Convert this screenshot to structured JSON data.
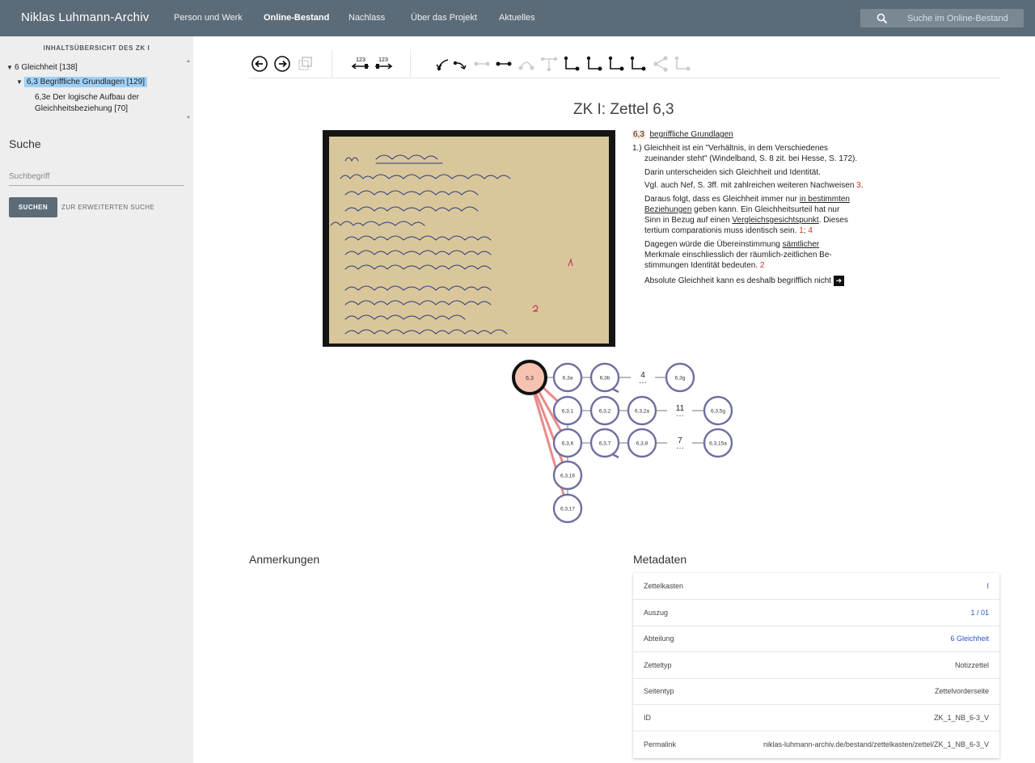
{
  "header": {
    "brand": "Niklas Luhmann-Archiv",
    "nav": [
      "Person und Werk",
      "Online-Bestand",
      "Nachlass",
      "Über das Projekt",
      "Aktuelles"
    ],
    "active_nav": "Online-Bestand",
    "search_placeholder": "Suche im Online-Bestand",
    "bg_color": "#5b6b78"
  },
  "sidebar": {
    "toc_title": "INHALTSÜBERSICHT DES ZK I",
    "tree": [
      {
        "label": "6 Gleichheit [138]",
        "expanded": true
      },
      {
        "label": "6,3 Begriffliche Grundlagen [129]",
        "expanded": true,
        "selected": true
      },
      {
        "label_line1": "6,3e Der logische Aufbau der",
        "label_line2": "Gleichheitsbeziehung [70]"
      }
    ],
    "search_heading": "Suche",
    "search_placeholder": "Suchbegriff",
    "search_button": "SUCHEN",
    "advanced_link": "ZUR ERWEITERTEN SUCHE"
  },
  "toolbar": {
    "icons": [
      "back-arrow-icon",
      "forward-arrow-icon",
      "copy-icon",
      "number-left-icon",
      "number-right-icon",
      "link-in-icon",
      "link-out-icon",
      "link-prev-icon",
      "link-next-icon",
      "link-arc-icon",
      "link-tree-icon",
      "link-down-icon",
      "link-down-icon",
      "link-down-icon",
      "link-down-icon",
      "share-icon",
      "link-down-icon"
    ],
    "num_label": "123"
  },
  "note": {
    "title": "ZK I: Zettel 6,3",
    "transcript": {
      "number": "6,3",
      "heading": "begriffliche Grundlagen",
      "l1": "1.) Gleichheit ist ein \"Verhältnis, in dem Verschiedenes",
      "l2": "zueinander steht\" (Windelband, S. 8 zit. bei Hesse, S. 172).",
      "l3": "Darin unterscheiden sich Gleichheit und Identität.",
      "l4a": "Vgl. auch Nef, S. 3ff. mit zahlreichen weiteren Nachweisen",
      "l4ref": "3",
      "l5a": "Daraus folgt, dass es Gleichheit immer nur",
      "l5u": "in bestimmten",
      "l6u": "Beziehungen",
      "l6b": "geben kann. Ein Gleichheitsurteil hat nur",
      "l7a": "Sinn in Bezug auf einen",
      "l7u": "Vergleichsgesichtspunkt",
      "l7b": ". Dieses",
      "l8a": "tertium comparationis muss identisch sein.",
      "l8r1": "1",
      "l8r2": "4",
      "l9a": "Dagegen würde die Übereinstimmung",
      "l9u": "sämtlicher",
      "l10": "Merkmale einschliesslich der räumlich-zeitlichen Be-",
      "l11a": "stimmungen Identität bedeuten.",
      "l11r": "2",
      "l12": "Absolute Gleichheit kann es deshalb begrifflich nicht"
    }
  },
  "graph": {
    "current": "6,3",
    "nodes": [
      "6,3a",
      "6,3b",
      "6,3g",
      "6,3,1",
      "6,3,2",
      "6,3,2a",
      "6,3,5g",
      "6,3,6",
      "6,3,7",
      "6,3,8",
      "6,3,15a",
      "6,3,16",
      "6,3,17"
    ],
    "gaps": [
      "4",
      "11",
      "7"
    ],
    "current_color": "#f7c3b1",
    "node_stroke": "#6f6fa0",
    "link_color": "#e88a8a"
  },
  "sections": {
    "notes_heading": "Anmerkungen",
    "meta_heading": "Metadaten"
  },
  "metadata": [
    {
      "key": "Zettelkasten",
      "value": "I",
      "link": true
    },
    {
      "key": "Auszug",
      "value": "1 / 01",
      "link": true
    },
    {
      "key": "Abteilung",
      "value": "6 Gleichheit",
      "link": true
    },
    {
      "key": "Zetteltyp",
      "value": "Notizzettel",
      "link": false
    },
    {
      "key": "Seitentyp",
      "value": "Zettelvorderseite",
      "link": false
    },
    {
      "key": "ID",
      "value": "ZK_1_NB_6-3_V",
      "link": false
    },
    {
      "key": "Permalink",
      "value": "niklas-luhmann-archiv.de/bestand/zettelkasten/zettel/ZK_1_NB_6-3_V",
      "link": false
    }
  ]
}
